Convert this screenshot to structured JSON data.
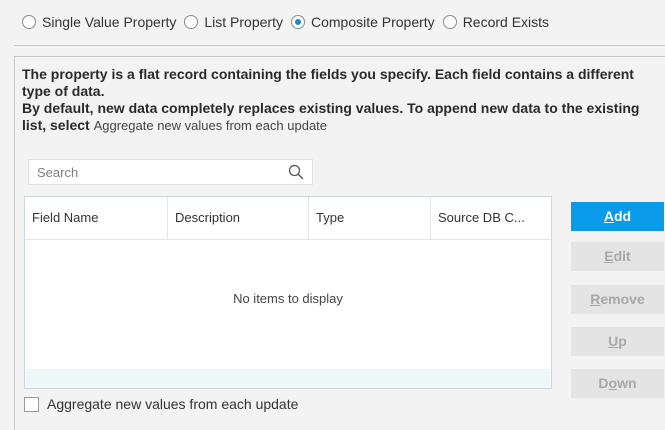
{
  "property_types": {
    "options": [
      {
        "label": "Single Value Property",
        "checked": false
      },
      {
        "label": "List Property",
        "checked": false
      },
      {
        "label": "Composite Property",
        "checked": true
      },
      {
        "label": "Record Exists",
        "checked": false
      }
    ]
  },
  "description": {
    "line1": "The property is a flat record containing the fields you specify. Each field contains a different type of data.",
    "line2": "By default, new data completely replaces existing values. To append new data to the existing list, select",
    "line2_option": "Aggregate new values from each update"
  },
  "search": {
    "placeholder": "Search"
  },
  "table": {
    "columns": [
      "Field Name",
      "Description",
      "Type",
      "Source DB C..."
    ],
    "empty_text": "No items to display"
  },
  "aggregate_checkbox": {
    "label": "Aggregate new values from each update",
    "checked": false
  },
  "buttons": {
    "add": {
      "label": "Add",
      "mnemonic": "A",
      "rest": "dd"
    },
    "edit": {
      "label": "Edit",
      "mnemonic": "E",
      "rest": "dit"
    },
    "remove": {
      "label": "Remove",
      "mnemonic": "R",
      "rest": "emove"
    },
    "up": {
      "label": "Up",
      "mnemonic": "U",
      "rest": "p"
    },
    "down": {
      "label": "Down",
      "mnemonic": "o",
      "pre": "D",
      "rest": "wn"
    }
  },
  "colors": {
    "accent": "#0a9aea",
    "radio_checked": "#1a86d0",
    "disabled_button": "#e4e4e4"
  }
}
